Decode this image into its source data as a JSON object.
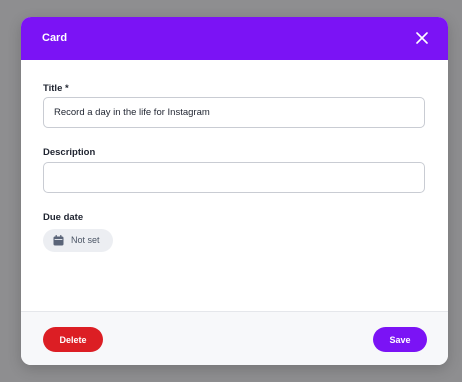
{
  "modal": {
    "title": "Card",
    "close_icon": "close-icon"
  },
  "form": {
    "title_label": "Title *",
    "title_value": "Record a day in the life for Instagram",
    "description_label": "Description",
    "description_value": "",
    "due_date_label": "Due date",
    "due_date_value": "Not set",
    "due_date_icon": "calendar-icon"
  },
  "footer": {
    "delete_label": "Delete",
    "save_label": "Save"
  },
  "colors": {
    "accent": "#7b13f5",
    "danger": "#dc1e24"
  }
}
